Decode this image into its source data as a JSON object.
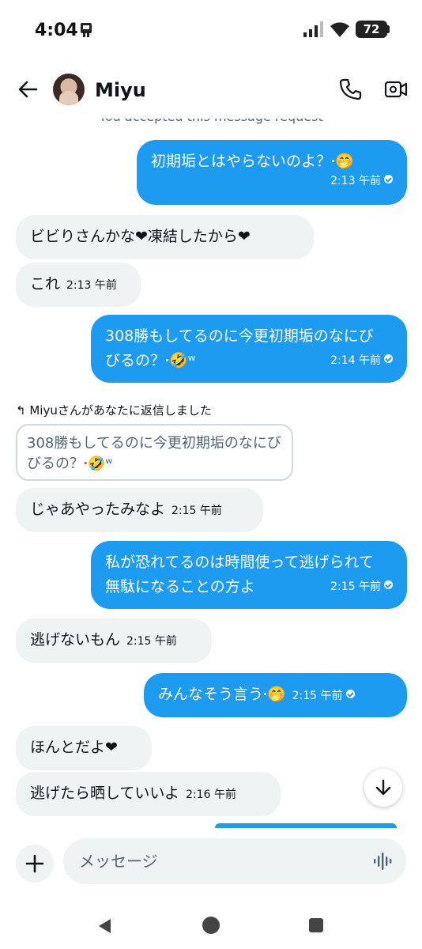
{
  "status_bar": {
    "time": "4:04",
    "battery": "72"
  },
  "header": {
    "contact_name": "Miyu"
  },
  "note": "You accepted this message request",
  "messages": [
    {
      "side": "out",
      "text": "初期垢とはやらないのよ？𐤟🤭",
      "time": "2:13 午前"
    },
    {
      "side": "in",
      "text": "ビビりさんかな❤凍結したから❤",
      "time": ""
    },
    {
      "side": "in",
      "text": "これ",
      "time": "2:13 午前"
    },
    {
      "side": "out",
      "text": "308勝もしてるのに今更初期垢のなにびびるの？𐤟🤣ʷ",
      "time": "2:14 午前"
    },
    {
      "side": "in",
      "text": "じゃあやったみなよ",
      "time": "2:15 午前"
    },
    {
      "side": "out",
      "text": "私が恐れてるのは時間使って逃げられて無駄になることの方よ",
      "time": "2:15 午前"
    },
    {
      "side": "in",
      "text": "逃げないもん",
      "time": "2:15 午前"
    },
    {
      "side": "out",
      "text": "みんなそう言う𐤟🤭",
      "time": "2:15 午前"
    },
    {
      "side": "in",
      "text": "ほんとだよ❤",
      "time": ""
    },
    {
      "side": "in",
      "text": "逃げたら晒していいよ",
      "time": "2:16 午前"
    }
  ],
  "reply": {
    "label": "Miyuさんがあなたに返信しました",
    "quoted": "308勝もしてるのに今更初期垢のなにびびるの？𐤟🤣ʷ"
  },
  "composer": {
    "placeholder": "メッセージ"
  },
  "colors": {
    "accent": "#1d9bf0",
    "incoming_bubble": "#eff3f4"
  }
}
